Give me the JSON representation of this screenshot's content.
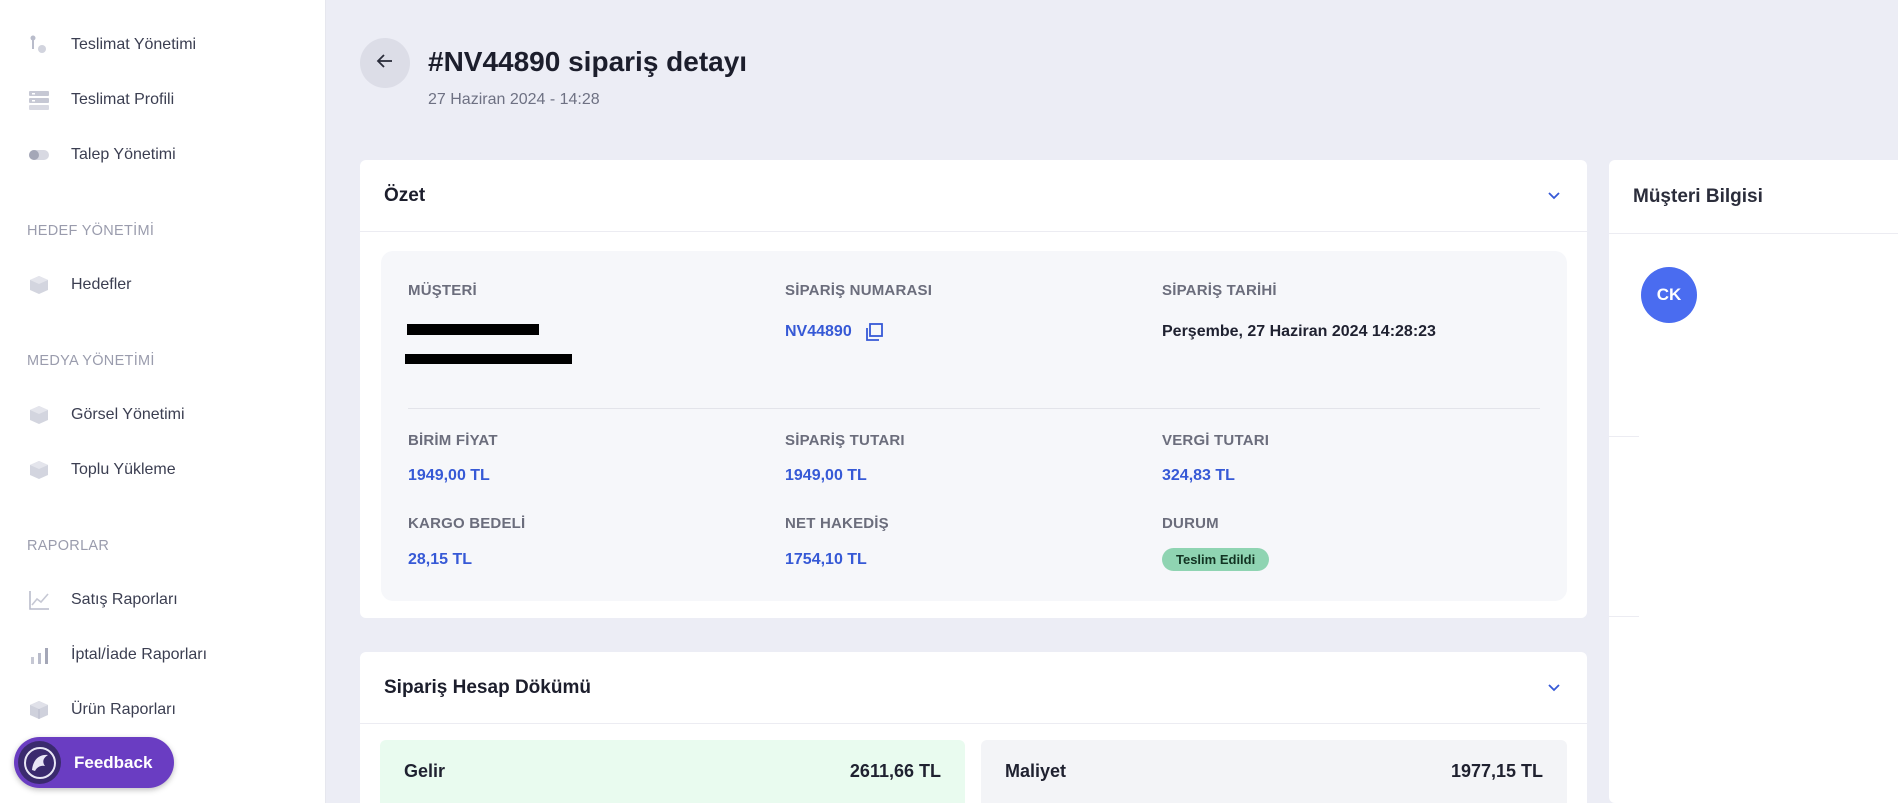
{
  "sidebar": {
    "items_top": [
      {
        "label": "Teslimat Yönetimi",
        "icon": "delivery-icon"
      },
      {
        "label": "Teslimat Profili",
        "icon": "server-icon"
      },
      {
        "label": "Talep Yönetimi",
        "icon": "toggle-icon"
      }
    ],
    "sections": [
      {
        "title": "HEDEF YÖNETİMİ",
        "items": [
          {
            "label": "Hedefler",
            "icon": "cube-icon"
          }
        ]
      },
      {
        "title": "MEDYA YÖNETİMİ",
        "items": [
          {
            "label": "Görsel Yönetimi",
            "icon": "cube-icon"
          },
          {
            "label": "Toplu Yükleme",
            "icon": "cube-icon"
          }
        ]
      },
      {
        "title": "RAPORLAR",
        "items": [
          {
            "label": "Satış Raporları",
            "icon": "line-chart-icon"
          },
          {
            "label": "İptal/İade Raporları",
            "icon": "bar-chart-icon"
          },
          {
            "label": "Ürün Raporları",
            "icon": "box-icon"
          }
        ]
      }
    ]
  },
  "feedback": {
    "label": "Feedback"
  },
  "header": {
    "title": "#NV44890 sipariş detayı",
    "date": "27 Haziran 2024 - 14:28"
  },
  "summary": {
    "title": "Özet",
    "customer_label": "MÜŞTERİ",
    "order_number_label": "SİPARİŞ NUMARASI",
    "order_number": "NV44890",
    "order_date_label": "SİPARİŞ TARİHİ",
    "order_date": "Perşembe, 27 Haziran 2024 14:28:23",
    "unit_price_label": "BİRİM FİYAT",
    "unit_price": "1949,00 TL",
    "order_total_label": "SİPARİŞ TUTARI",
    "order_total": "1949,00 TL",
    "tax_label": "VERGİ TUTARI",
    "tax": "324,83 TL",
    "shipping_label": "KARGO BEDELİ",
    "shipping": "28,15 TL",
    "net_label": "NET HAKEDİŞ",
    "net": "1754,10 TL",
    "status_label": "DURUM",
    "status": "Teslim Edildi"
  },
  "breakdown": {
    "title": "Sipariş Hesap Dökümü",
    "income_label": "Gelir",
    "income": "2611,66 TL",
    "cost_label": "Maliyet",
    "cost": "1977,15 TL"
  },
  "customer_panel": {
    "title": "Müşteri Bilgisi",
    "initials": "CK"
  },
  "colors": {
    "accent": "#3659d6",
    "status_badge": "#8fd4b2",
    "income_bg": "#e9fbef",
    "feedback": "#6a3dc2"
  }
}
